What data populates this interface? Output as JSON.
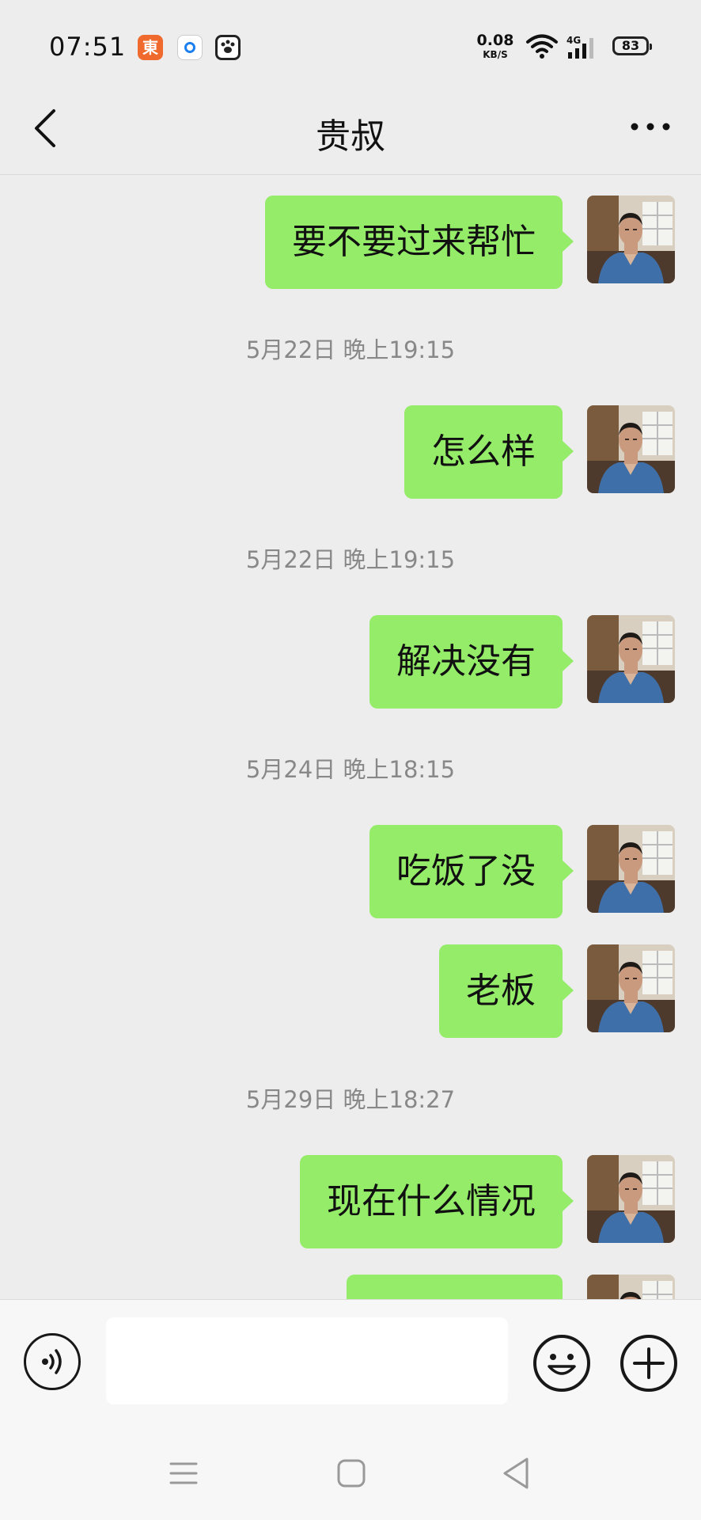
{
  "status_bar": {
    "time": "07:51",
    "app_badge_1": "東",
    "net_speed_value": "0.08",
    "net_speed_unit": "KB/S",
    "network_type": "4G",
    "battery": "83"
  },
  "header": {
    "title": "贵叔"
  },
  "chat": {
    "messages": [
      {
        "type": "sent",
        "text": "要不要过来帮忙"
      },
      {
        "type": "time",
        "text": "5月22日 晚上19:15"
      },
      {
        "type": "sent",
        "text": "怎么样"
      },
      {
        "type": "time",
        "text": "5月22日 晚上19:15"
      },
      {
        "type": "sent",
        "text": "解决没有"
      },
      {
        "type": "time",
        "text": "5月24日 晚上18:15"
      },
      {
        "type": "sent",
        "text": "吃饭了没"
      },
      {
        "type": "sent",
        "text": "老板"
      },
      {
        "type": "time",
        "text": "5月29日 晚上18:27"
      },
      {
        "type": "sent",
        "text": "现在什么情况"
      },
      {
        "type": "sent",
        "text": ""
      }
    ]
  },
  "input_bar": {
    "value": "",
    "placeholder": ""
  },
  "colors": {
    "sent_bubble": "#95ec69",
    "background": "#ededed",
    "timestamp": "#888888"
  },
  "icons": [
    "back-arrow-icon",
    "more-icon",
    "voice-icon",
    "emoji-icon",
    "plus-icon",
    "nav-menu-icon",
    "nav-home-icon",
    "nav-back-icon",
    "wifi-icon",
    "signal-icon",
    "battery-icon"
  ]
}
